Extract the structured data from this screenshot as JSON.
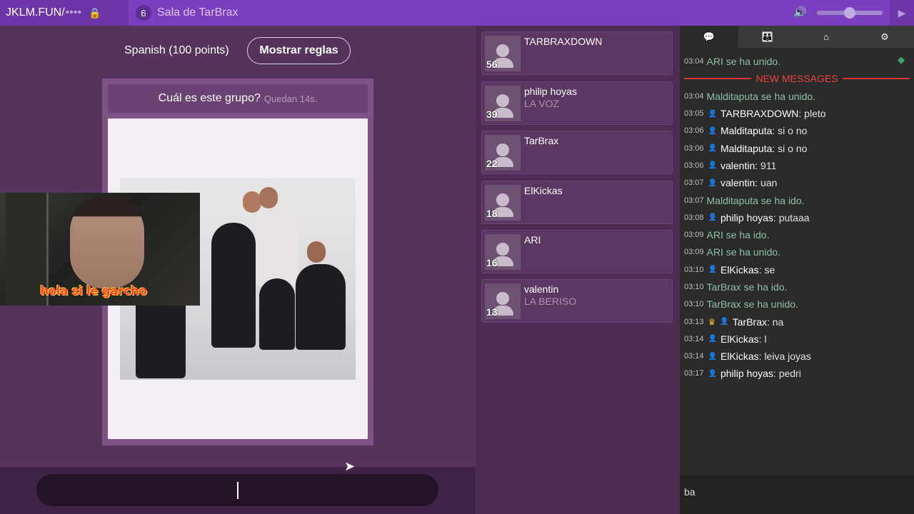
{
  "topbar": {
    "site": "JKLM.FUN/",
    "room_code_masked": "••••",
    "player_count": "6",
    "room_name": "Sala de TarBrax"
  },
  "game": {
    "language_label": "Spanish (100 points)",
    "rules_button": "Mostrar reglas",
    "question": "Cuál es este grupo?",
    "timer": "Quedan 14s.",
    "webcam_caption": "hola si le garcho"
  },
  "scoreboard": {
    "players": [
      {
        "name": "TARBRAXDOWN",
        "score": "56",
        "answer": ""
      },
      {
        "name": "philip hoyas",
        "score": "39",
        "answer": "LA VOZ"
      },
      {
        "name": "TarBrax",
        "score": "22",
        "answer": ""
      },
      {
        "name": "ElKickas",
        "score": "18",
        "answer": ""
      },
      {
        "name": "ARI",
        "score": "16",
        "answer": ""
      },
      {
        "name": "valentin",
        "score": "13",
        "answer": "LA BERISO"
      }
    ]
  },
  "chat": {
    "tabs": [
      "chat-icon",
      "players-icon",
      "home-icon",
      "gear-icon"
    ],
    "new_messages_label": "NEW MESSAGES",
    "first_line": {
      "time": "03:04",
      "text": "ARI se ha unido."
    },
    "lines": [
      {
        "time": "03:04",
        "type": "system",
        "text": "Malditaputa se ha unido."
      },
      {
        "time": "03:05",
        "type": "msg",
        "author": "TARBRAXDOWN",
        "text": ": pleto"
      },
      {
        "time": "03:06",
        "type": "msg",
        "author": "Malditaputa",
        "text": ": si o no"
      },
      {
        "time": "03:06",
        "type": "msg",
        "author": "Malditaputa",
        "text": ": si o no"
      },
      {
        "time": "03:06",
        "type": "msg",
        "author": "valentin",
        "text": ": 911"
      },
      {
        "time": "03:07",
        "type": "msg",
        "author": "valentin",
        "text": ": uan"
      },
      {
        "time": "03:07",
        "type": "system",
        "text": "Malditaputa se ha ido."
      },
      {
        "time": "03:08",
        "type": "msg",
        "author": "philip hoyas",
        "text": ": putaaa"
      },
      {
        "time": "03:09",
        "type": "system",
        "text": "ARI se ha ido."
      },
      {
        "time": "03:09",
        "type": "system",
        "text": "ARI se ha unido."
      },
      {
        "time": "03:10",
        "type": "msg",
        "author": "ElKickas",
        "text": ": se"
      },
      {
        "time": "03:10",
        "type": "system",
        "text": "TarBrax se ha ido."
      },
      {
        "time": "03:10",
        "type": "system",
        "text": "TarBrax se ha unido."
      },
      {
        "time": "03:13",
        "type": "leader",
        "author": "TarBrax",
        "text": ": na"
      },
      {
        "time": "03:14",
        "type": "msg",
        "author": "ElKickas",
        "text": ": l"
      },
      {
        "time": "03:14",
        "type": "msg",
        "author": "ElKickas",
        "text": ": leiva joyas"
      },
      {
        "time": "03:17",
        "type": "msg",
        "author": "philip hoyas",
        "text": ": pedri"
      }
    ],
    "input_value": "ba"
  },
  "colors": {
    "topbar": "#7a3fbf",
    "game_bg": "#54345b",
    "chat_bg": "#2b2b2b",
    "system_text": "#8fbfa4",
    "new_messages": "#e8423e"
  }
}
